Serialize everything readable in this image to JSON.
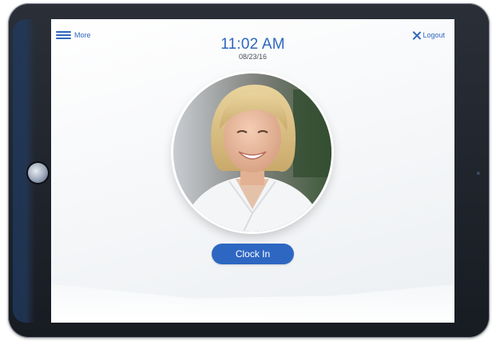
{
  "header": {
    "menu_label": "More",
    "menu_icon": "hamburger-icon",
    "logout_label": "Logout",
    "logout_icon": "close-icon"
  },
  "clock": {
    "time": "11:02 AM",
    "date": "08/23/16"
  },
  "actions": {
    "clock_in_label": "Clock In"
  },
  "colors": {
    "accent": "#2f67bd",
    "button": "#2d67c2",
    "frame": "#1b2029"
  }
}
